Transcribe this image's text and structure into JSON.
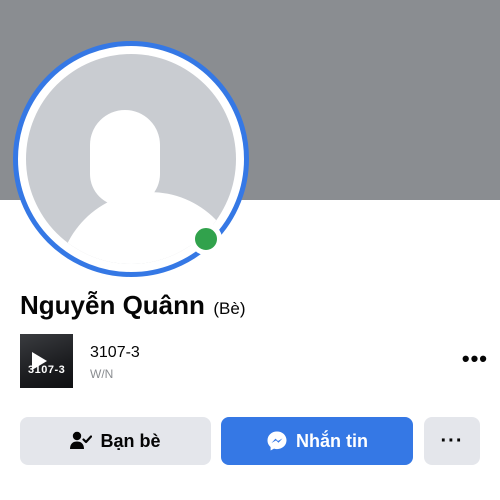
{
  "profile": {
    "name": "Nguyễn Quânn",
    "alternate_name": "(Bè)",
    "online": true
  },
  "work": {
    "thumbnail_text": "3107-3",
    "title": "3107-3",
    "subtitle": "W/N"
  },
  "actions": {
    "friends_label": "Bạn bè",
    "message_label": "Nhắn tin",
    "more_label": "···"
  },
  "more_menu_label": "•••",
  "icons": {
    "avatar": "default-avatar-icon",
    "online": "online-status-dot",
    "friends": "person-check-icon",
    "message": "messenger-icon",
    "more": "ellipsis-icon"
  },
  "colors": {
    "cover": "#8a8d91",
    "ring": "#3578e5",
    "online": "#31a24c",
    "primary_button": "#3578e5",
    "secondary_button": "#e4e6eb"
  }
}
